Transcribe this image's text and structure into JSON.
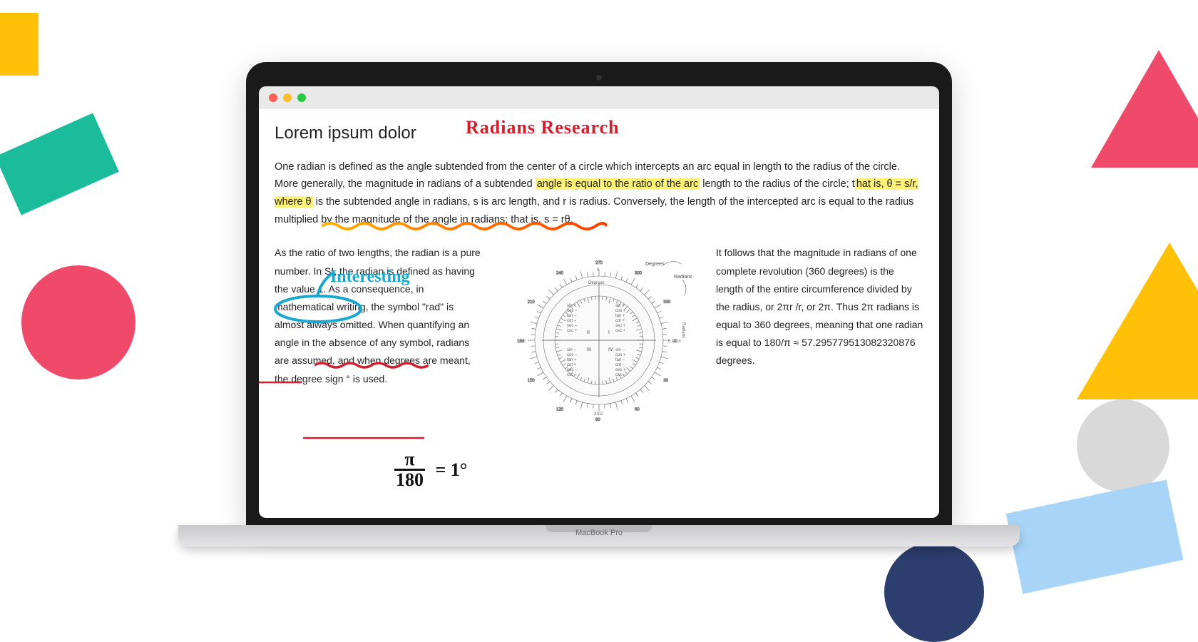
{
  "document": {
    "title": "Lorem ipsum dolor",
    "intro_before_hl1": "One radian is defined as the angle subtended from the center of a circle which intercepts an arc equal in length to the radius of the circle. More generally, the magnitude in radians of a subtended ",
    "hl1": "angle is equal to the ratio of the arc",
    "intro_mid1": " length to the radius of the circle; t",
    "hl2": "hat is, θ = s/r, where θ",
    "intro_after_hl2": " is the subtended angle in radians, s is arc length, and r is radius. Conversely, the length of the intercepted arc is equal to the radius multiplied by the magnitude of the angle in radians; that is, s = rθ.",
    "col_left": "As the ratio of two lengths, the radian is a pure number. In SI, the radian is defined as having the value 1. As a consequence, in mathematical writing, the symbol \"rad\" is almost always omitted. When quantifying an angle in the absence of any symbol, radians are assumed, and when degrees are meant, the degree sign ° is used.",
    "col_right": "It follows that the magnitude in radians of one complete revolution (360 degrees) is the length of the entire circumference divided by the radius, or 2πr /r, or 2π. Thus 2π radians is equal to 360 degrees, meaning that one radian is equal to 180/π ≈ 57.295779513082320876 degrees."
  },
  "annotations": {
    "red_title": "Radians Research",
    "blue_note": "Interesting",
    "formula_top": "π",
    "formula_bottom": "180",
    "formula_right": "= 1°"
  },
  "diagram": {
    "label_degrees": "Degrees",
    "label_radians": "Radians",
    "trig_rows": [
      "sin",
      "cos",
      "tan",
      "cot",
      "sec",
      "csc"
    ],
    "quadrants": [
      "I",
      "II",
      "III",
      "IV"
    ]
  },
  "device": {
    "label": "MacBook Pro"
  }
}
